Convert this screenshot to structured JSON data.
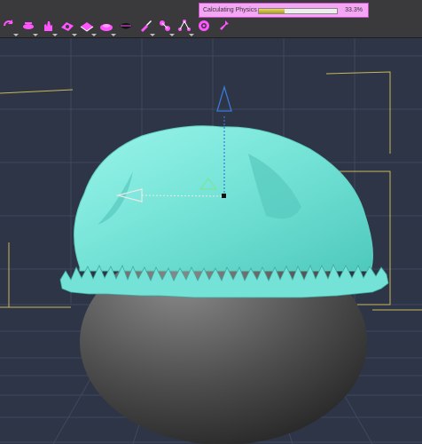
{
  "progress": {
    "label": "Calculating Physics",
    "percent_text": "33.3%",
    "fraction": 0.333
  },
  "toolbar": {
    "tools": [
      {
        "icon": "rotate-icon"
      },
      {
        "icon": "translate-icon"
      },
      {
        "icon": "hand-icon"
      },
      {
        "icon": "joint-editor-icon"
      },
      {
        "icon": "geometry-editor-icon"
      },
      {
        "icon": "morph-brush-icon"
      },
      {
        "icon": "lips-icon"
      },
      {
        "icon": "brush-icon"
      },
      {
        "icon": "node-weight-icon"
      },
      {
        "icon": "hierarchy-icon"
      },
      {
        "icon": "target-icon"
      },
      {
        "icon": "pin-icon"
      }
    ],
    "accent_color": "#ff55ff"
  },
  "viewport": {
    "background": "#2e3546",
    "grid_color": "#3f4860",
    "cloth_color": "#7ae8dc",
    "sphere_color": "#4a4a4a"
  }
}
